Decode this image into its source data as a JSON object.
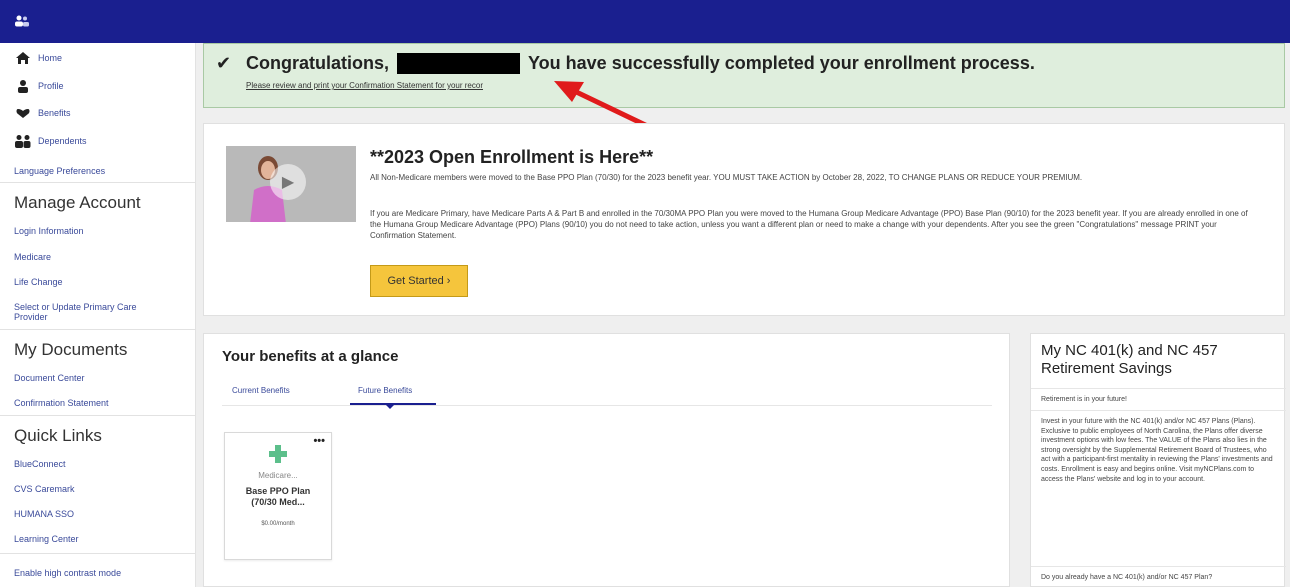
{
  "topbar": {
    "icon": "users-icon",
    "color": "#1a1f8f"
  },
  "sidebar": {
    "nav": [
      {
        "label": "Home",
        "icon": "home-icon"
      },
      {
        "label": "Profile",
        "icon": "person-icon"
      },
      {
        "label": "Benefits",
        "icon": "benefits-icon"
      },
      {
        "label": "Dependents",
        "icon": "dependents-icon"
      }
    ],
    "language": "Language Preferences",
    "manage_account": {
      "heading": "Manage Account",
      "links": [
        "Login Information",
        "Medicare",
        "Life Change",
        "Select or Update Primary Care Provider"
      ]
    },
    "my_documents": {
      "heading": "My Documents",
      "links": [
        "Document Center",
        "Confirmation Statement"
      ]
    },
    "quick_links": {
      "heading": "Quick Links",
      "links": [
        "BlueConnect",
        "CVS Caremark",
        "HUMANA SSO",
        "Learning Center"
      ]
    },
    "contrast": "Enable high contrast mode"
  },
  "congrats": {
    "greeting": "Congratulations,",
    "message": "You have successfully completed your enrollment process.",
    "sub_link": "Please review and print your Confirmation Statement for your recor"
  },
  "enrollment": {
    "title": "**2023 Open Enrollment is Here**",
    "para1": "All Non-Medicare members were moved to the Base PPO Plan (70/30) for the 2023 benefit year. YOU MUST TAKE ACTION by October 28, 2022, TO CHANGE PLANS OR REDUCE YOUR PREMIUM.",
    "para2": "If you are Medicare Primary, have Medicare Parts A & Part B and enrolled in the 70/30MA PPO Plan you were moved to the Humana Group Medicare Advantage (PPO) Base Plan (90/10) for the 2023 benefit year. If you are already enrolled in one of the Humana Group Medicare Advantage (PPO) Plans (90/10) you do not need to take action, unless you want a different plan or need to make a change with your dependents. After you see the green \"Congratulations\" message PRINT your Confirmation Statement.",
    "button": "Get Started ›"
  },
  "benefits": {
    "title": "Your benefits at a glance",
    "tabs": [
      "Current Benefits",
      "Future Benefits"
    ],
    "active_tab": "Future Benefits",
    "card": {
      "menu": "•••",
      "category": "Medicare...",
      "plan_line1": "Base PPO Plan",
      "plan_line2": "(70/30 Med...",
      "price": "$0.00/month",
      "icon": "medical-plus-icon",
      "icon_color": "#5cbf8b"
    }
  },
  "retirement": {
    "title": "My NC 401(k) and NC 457 Retirement Savings",
    "tagline": "Retirement is in your future!",
    "body": "Invest in your future with the NC 401(k) and/or NC 457 Plans (Plans). Exclusive to public employees of North Carolina, the Plans offer diverse investment options with low fees. The VALUE of the Plans also lies in the strong oversight by the Supplemental Retirement Board of Trustees, who act with a participant-first mentality in reviewing the Plans' investments and costs. Enrollment is easy and begins online. Visit myNCPlans.com to access the Plans' website and log in to your account.",
    "question": "Do you already have a NC 401(k) and/or NC 457 Plan?"
  },
  "accent_colors": {
    "arrow": "#e01b1b",
    "button": "#f5c53c",
    "success_bg": "#dfeedd"
  }
}
